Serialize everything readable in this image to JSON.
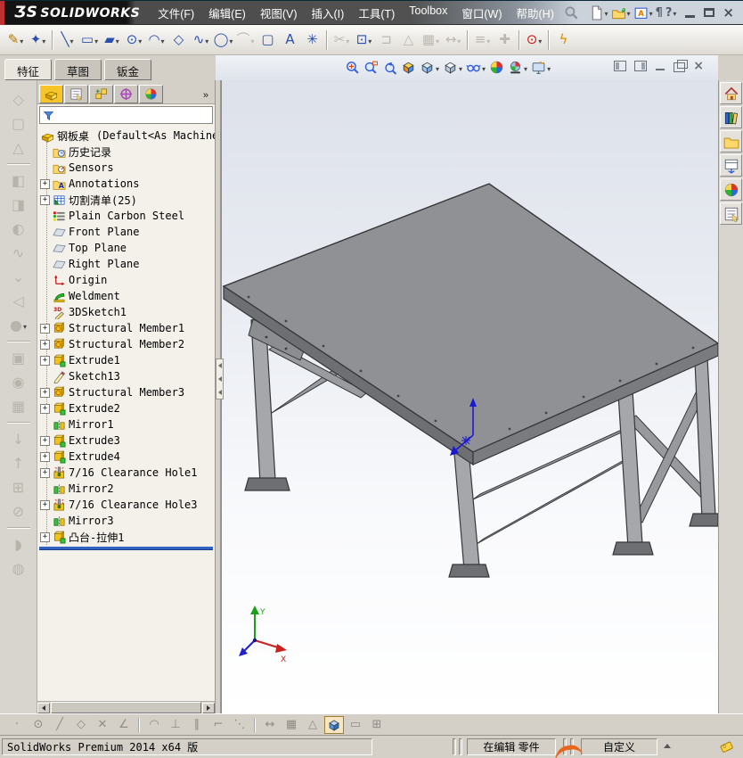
{
  "titlebar": {
    "logo_prefix": "ƷS",
    "logo_text": "SOLIDWORKS",
    "menus": [
      "文件(F)",
      "编辑(E)",
      "视图(V)",
      "插入(I)",
      "工具(T)",
      "Toolbox",
      "窗口(W)",
      "帮助(H)"
    ],
    "quick": [
      {
        "name": "new-document",
        "icon": "newdoc",
        "dd": true
      },
      {
        "name": "open-document",
        "icon": "open",
        "dd": true
      },
      {
        "name": "solidworks-resources",
        "icon": "resources",
        "dd": true
      },
      {
        "name": "properties",
        "glyph": "¶"
      },
      {
        "name": "help",
        "glyph": "?",
        "dd": true
      }
    ],
    "window_buttons": [
      {
        "name": "minimize"
      },
      {
        "name": "maximize"
      },
      {
        "name": "close"
      }
    ]
  },
  "sketch_toolbar": {
    "items": [
      {
        "name": "sketch",
        "glyph": "✎",
        "color": "#b07800",
        "dd": true
      },
      {
        "name": "smart-dimension",
        "glyph": "✦",
        "dd": true
      },
      {
        "sep": true
      },
      {
        "name": "line",
        "glyph": "╲",
        "dd": true
      },
      {
        "name": "corner-rectangle",
        "glyph": "▭",
        "dd": true
      },
      {
        "name": "straight-slot",
        "glyph": "▰",
        "dd": true
      },
      {
        "name": "circle",
        "glyph": "⊙",
        "dd": true
      },
      {
        "name": "centerpoint-arc",
        "glyph": "◠",
        "dd": true
      },
      {
        "name": "polygon",
        "glyph": "◇"
      },
      {
        "name": "spline",
        "glyph": "∿",
        "dd": true
      },
      {
        "name": "ellipse",
        "glyph": "◯",
        "dd": true
      },
      {
        "name": "sketch-fillet",
        "glyph": "⌒",
        "disabled": true,
        "dd": true
      },
      {
        "name": "selection-box",
        "glyph": "▢"
      },
      {
        "name": "text",
        "glyph": "A"
      },
      {
        "name": "point",
        "glyph": "✳"
      },
      {
        "sep": true
      },
      {
        "name": "trim-entities",
        "glyph": "✂",
        "disabled": true,
        "dd": true
      },
      {
        "name": "convert-entities",
        "glyph": "⊡",
        "dd": true
      },
      {
        "name": "offset-entities",
        "glyph": "⊐",
        "disabled": true
      },
      {
        "name": "mirror-entities",
        "glyph": "△",
        "disabled": true
      },
      {
        "name": "linear-sketch-pattern",
        "glyph": "▦",
        "disabled": true,
        "dd": true
      },
      {
        "name": "move-entities",
        "glyph": "↔",
        "disabled": true,
        "dd": true
      },
      {
        "sep": true
      },
      {
        "name": "display-relations",
        "glyph": "≡",
        "disabled": true,
        "dd": true
      },
      {
        "name": "add-relation",
        "glyph": "✚",
        "disabled": true
      },
      {
        "sep": true
      },
      {
        "name": "no-external-references",
        "glyph": "⊙",
        "color": "#c81414",
        "dd": true
      },
      {
        "sep": true
      },
      {
        "name": "quick-snaps",
        "glyph": "ϟ",
        "color": "#d89000"
      }
    ]
  },
  "command_tabs": [
    {
      "label": "特征",
      "active": true
    },
    {
      "label": "草图",
      "active": false
    },
    {
      "label": "钣金",
      "active": false
    }
  ],
  "headsup": [
    {
      "name": "zoom-to-fit",
      "icon": "zoomfit"
    },
    {
      "name": "zoom-to-area",
      "icon": "zoomarea"
    },
    {
      "name": "previous-view",
      "icon": "prevview"
    },
    {
      "name": "section-view",
      "icon": "section"
    },
    {
      "name": "view-orientation",
      "icon": "vieworient",
      "dd": true
    },
    {
      "name": "display-style",
      "icon": "displaystyle",
      "dd": true
    },
    {
      "name": "hide-show-items",
      "icon": "hideshow",
      "dd": true
    },
    {
      "name": "edit-appearance",
      "icon": "ball"
    },
    {
      "name": "apply-scene",
      "icon": "scene",
      "dd": true
    },
    {
      "name": "view-settings",
      "icon": "viewsettings",
      "dd": true
    }
  ],
  "doc_window_buttons": [
    {
      "name": "pane-left"
    },
    {
      "name": "pane-right"
    },
    {
      "name": "minimize-document"
    },
    {
      "name": "restore-document"
    },
    {
      "name": "close-document"
    }
  ],
  "left_toolbar": {
    "items": [
      {
        "name": "insert-bends",
        "glyph": "◇"
      },
      {
        "name": "base-flange",
        "glyph": "▢"
      },
      {
        "name": "lofted-bend",
        "glyph": "△"
      },
      {
        "sep": true
      },
      {
        "name": "edge-flange",
        "glyph": "◧"
      },
      {
        "name": "miter-flange",
        "glyph": "◨"
      },
      {
        "name": "hem",
        "glyph": "◐"
      },
      {
        "name": "jog",
        "glyph": "∿"
      },
      {
        "name": "sketched-bend",
        "glyph": "⌄"
      },
      {
        "name": "closed-corner",
        "glyph": "◁"
      },
      {
        "name": "forming-tool",
        "glyph": "●",
        "dd": true
      },
      {
        "sep": true
      },
      {
        "name": "extruded-cut",
        "glyph": "▣"
      },
      {
        "name": "simple-hole",
        "glyph": "◉"
      },
      {
        "name": "vent",
        "glyph": "▦"
      },
      {
        "sep": true
      },
      {
        "name": "unfold",
        "glyph": "↓"
      },
      {
        "name": "fold",
        "glyph": "↑"
      },
      {
        "name": "flatten",
        "glyph": "⊞"
      },
      {
        "name": "no-bends",
        "glyph": "⊘"
      },
      {
        "sep": true
      },
      {
        "name": "rip",
        "glyph": "◗"
      },
      {
        "name": "convert-to-sheet-metal",
        "glyph": "◍"
      }
    ]
  },
  "feature_panel": {
    "header_tabs": [
      {
        "name": "featuremanager-tree",
        "icon": "part",
        "active": true
      },
      {
        "name": "propertymanager",
        "icon": "propmgr"
      },
      {
        "name": "configurationmanager",
        "icon": "configmgr"
      },
      {
        "name": "dimxpertmanager",
        "icon": "dimxpert"
      },
      {
        "name": "displaymanager",
        "icon": "ball"
      }
    ],
    "overflow": "»",
    "filter": {
      "value": "",
      "placeholder": ""
    },
    "root": {
      "label": "钢板桌",
      "config": "(Default<As Machined>",
      "icon": "part"
    },
    "tree": [
      {
        "label": "历史记录",
        "icon": "history"
      },
      {
        "label": "Sensors",
        "icon": "sensors"
      },
      {
        "label": "Annotations",
        "icon": "annotations",
        "plus": true
      },
      {
        "label": "切割清单(25)",
        "icon": "cutlist",
        "plus": true
      },
      {
        "label": "Plain Carbon Steel",
        "icon": "material"
      },
      {
        "label": "Front Plane",
        "icon": "plane"
      },
      {
        "label": "Top Plane",
        "icon": "plane"
      },
      {
        "label": "Right Plane",
        "icon": "plane"
      },
      {
        "label": "Origin",
        "icon": "origin"
      },
      {
        "label": "Weldment",
        "icon": "weldment"
      },
      {
        "label": "3DSketch1",
        "icon": "sketch3d"
      },
      {
        "label": "Structural Member1",
        "icon": "member",
        "plus": true
      },
      {
        "label": "Structural Member2",
        "icon": "member",
        "plus": true
      },
      {
        "label": "Extrude1",
        "icon": "extrude",
        "plus": true
      },
      {
        "label": "Sketch13",
        "icon": "sketch"
      },
      {
        "label": "Structural Member3",
        "icon": "member",
        "plus": true
      },
      {
        "label": "Extrude2",
        "icon": "extrude",
        "plus": true
      },
      {
        "label": "Mirror1",
        "icon": "mirror"
      },
      {
        "label": "Extrude3",
        "icon": "extrude",
        "plus": true
      },
      {
        "label": "Extrude4",
        "icon": "extrude",
        "plus": true
      },
      {
        "label": "7/16 Clearance Hole1",
        "icon": "hole",
        "plus": true
      },
      {
        "label": "Mirror2",
        "icon": "mirror"
      },
      {
        "label": "7/16 Clearance Hole3",
        "icon": "hole",
        "plus": true
      },
      {
        "label": "Mirror3",
        "icon": "mirror"
      },
      {
        "label": "凸台-拉伸1",
        "icon": "extrude",
        "plus": true
      }
    ]
  },
  "viewport": {
    "model_name": "steel-plate-table-weldment",
    "triad_colors": {
      "x": "#cc2020",
      "y": "#18a018",
      "z": "#2020cc"
    },
    "reference_triad_color": "#1a1ad0"
  },
  "task_pane": {
    "tabs": [
      {
        "name": "solidworks-resources-tab",
        "icon": "home"
      },
      {
        "name": "design-library-tab",
        "icon": "library"
      },
      {
        "name": "file-explorer-tab",
        "icon": "folder"
      },
      {
        "name": "view-palette-tab",
        "icon": "palette"
      },
      {
        "name": "appearances-scenes-tab",
        "icon": "ball"
      },
      {
        "name": "custom-properties-tab",
        "icon": "propmgr"
      }
    ]
  },
  "bottom_toolbar": {
    "items": [
      {
        "name": "snap-points",
        "glyph": "·"
      },
      {
        "name": "snap-center",
        "glyph": "⊙"
      },
      {
        "name": "snap-line",
        "glyph": "╱"
      },
      {
        "name": "snap-midpoint",
        "glyph": "◇"
      },
      {
        "name": "snap-intersection",
        "gl yph": "✕",
        "glyph": "✕"
      },
      {
        "name": "snap-angle",
        "glyph": "∠"
      },
      {
        "sep": true
      },
      {
        "name": "snap-tangent",
        "glyph": "◠"
      },
      {
        "name": "snap-perpendicular",
        "glyph": "⊥"
      },
      {
        "name": "snap-parallel",
        "glyph": "∥"
      },
      {
        "name": "snap-horizontal-vertical",
        "glyph": "⌐"
      },
      {
        "name": "snap-to-points",
        "glyph": "⋱"
      },
      {
        "sep": true
      },
      {
        "name": "snap-length",
        "glyph": "↔"
      },
      {
        "name": "snap-grid",
        "glyph": "▦"
      },
      {
        "name": "snap-angle-lines",
        "glyph": "△"
      },
      {
        "name": "shaded-view",
        "icon": "cube3d",
        "active": true
      },
      {
        "name": "single-viewport",
        "glyph": "▭"
      },
      {
        "name": "four-viewports",
        "glyph": "⊞"
      }
    ]
  },
  "statusbar": {
    "product": "SolidWorks Premium 2014 x64 版",
    "editing": "在编辑 零件",
    "custom": "自定义"
  },
  "colors": {
    "rollback_bar": "#2f62c2",
    "table_gray": "#8f9195",
    "viewport_top": "#dde1ea"
  }
}
